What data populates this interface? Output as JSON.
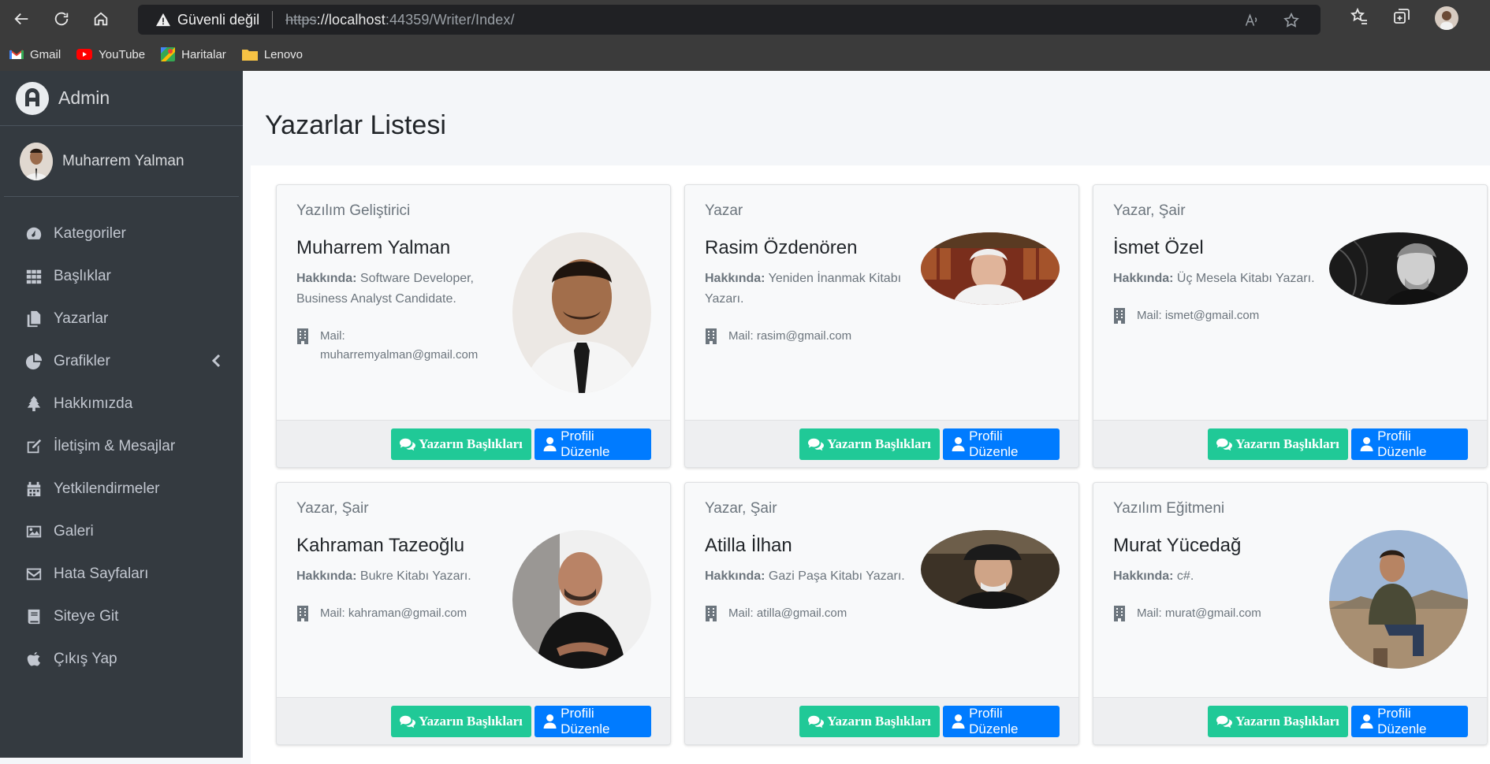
{
  "browser": {
    "security_label": "Güvenli değil",
    "url_scheme": "https",
    "url_host": "://localhost",
    "url_rest": ":44359/Writer/Index/",
    "bookmarks": [
      {
        "label": "Gmail",
        "icon": "gmail-icon"
      },
      {
        "label": "YouTube",
        "icon": "youtube-icon"
      },
      {
        "label": "Haritalar",
        "icon": "maps-icon"
      },
      {
        "label": "Lenovo",
        "icon": "folder-icon"
      }
    ]
  },
  "sidebar": {
    "brand": "Admin",
    "user_name": "Muharrem Yalman",
    "items": [
      {
        "label": "Kategoriler",
        "icon": "dashboard-icon"
      },
      {
        "label": "Başlıklar",
        "icon": "grid-icon"
      },
      {
        "label": "Yazarlar",
        "icon": "copy-icon"
      },
      {
        "label": "Grafikler",
        "icon": "pie-chart-icon"
      },
      {
        "label": "Hakkımızda",
        "icon": "tree-icon"
      },
      {
        "label": "İletişim & Mesajlar",
        "icon": "edit-icon"
      },
      {
        "label": "Yetkilendirmeler",
        "icon": "calendar-icon"
      },
      {
        "label": "Galeri",
        "icon": "image-icon"
      },
      {
        "label": "Hata Sayfaları",
        "icon": "envelope-icon"
      },
      {
        "label": "Siteye Git",
        "icon": "book-icon"
      },
      {
        "label": "Çıkış Yap",
        "icon": "apple-icon"
      }
    ]
  },
  "main": {
    "title": "Yazarlar Listesi",
    "about_label": "Hakkında:",
    "btn_titles": "Yazarın Başlıkları",
    "btn_edit": "Profili Düzenle",
    "writers": [
      {
        "role": "Yazılım Geliştirici",
        "name": "Muharrem Yalman",
        "about": "Software Developer, Business Analyst Candidate.",
        "mail": "Mail: muharremyalman@gmail.com"
      },
      {
        "role": "Yazar",
        "name": "Rasim Özdenören",
        "about": "Yeniden İnanmak Kitabı Yazarı.",
        "mail": "Mail: rasim@gmail.com"
      },
      {
        "role": "Yazar, Şair",
        "name": "İsmet Özel",
        "about": "Üç Mesela Kitabı Yazarı.",
        "mail": "Mail: ismet@gmail.com"
      },
      {
        "role": "Yazar, Şair",
        "name": "Kahraman Tazeoğlu",
        "about": "Bukre Kitabı Yazarı.",
        "mail": "Mail: kahraman@gmail.com"
      },
      {
        "role": "Yazar, Şair",
        "name": "Atilla İlhan",
        "about": "Gazi Paşa Kitabı Yazarı.",
        "mail": "Mail: atilla@gmail.com"
      },
      {
        "role": "Yazılım Eğitmeni",
        "name": "Murat Yücedağ",
        "about": "c#.",
        "mail": "Mail: murat@gmail.com"
      }
    ]
  },
  "colors": {
    "sidebar": "#343a40",
    "green": "#20c997",
    "blue": "#007bff"
  }
}
